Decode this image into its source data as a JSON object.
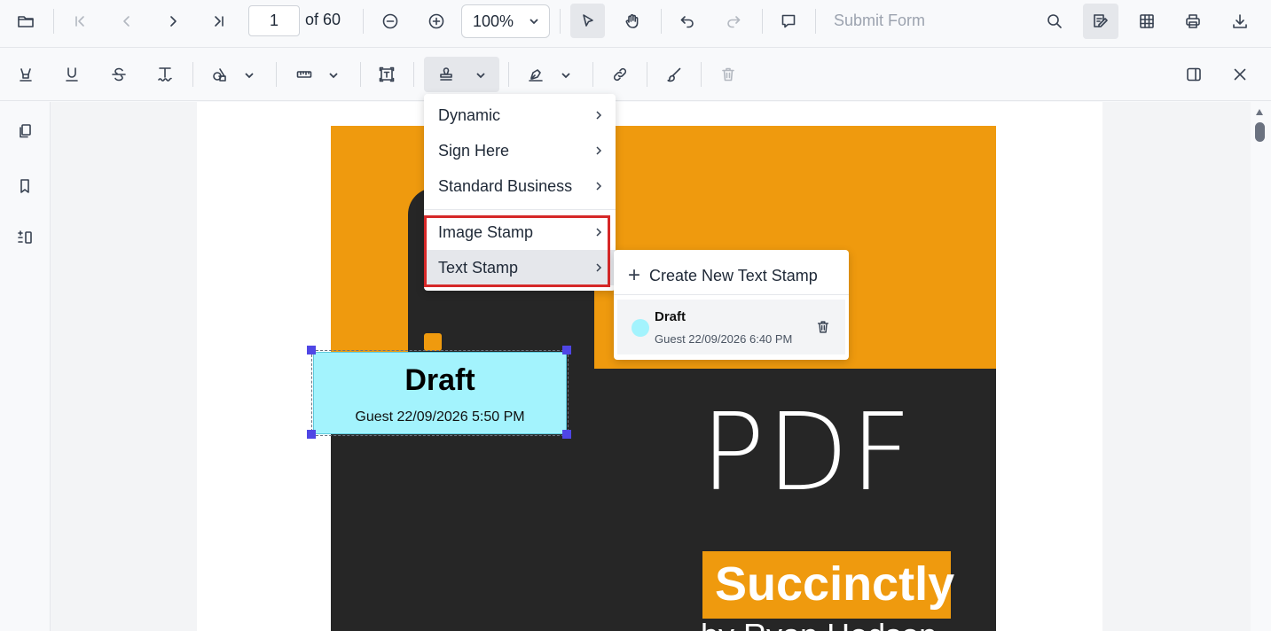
{
  "toolbar": {
    "page_current": "1",
    "page_of": "of 60",
    "zoom": "100%",
    "submit_form": "Submit Form"
  },
  "stamp_menu": {
    "items": [
      {
        "label": "Dynamic"
      },
      {
        "label": "Sign Here"
      },
      {
        "label": "Standard Business"
      },
      {
        "label": "Image Stamp"
      },
      {
        "label": "Text Stamp"
      }
    ]
  },
  "text_stamp_submenu": {
    "create_label": "Create New Text Stamp",
    "saved": {
      "name": "Draft",
      "meta": "Guest 22/09/2026 6:40 PM",
      "color": "#a3f3fd"
    }
  },
  "placed_stamp": {
    "title": "Draft",
    "meta": "Guest 22/09/2026 5:50 PM",
    "color": "#a3f3fd"
  },
  "document": {
    "cover_title": "PDF",
    "cover_subtitle": "Succinctly",
    "cover_byline": "by Ryan Hodson",
    "accent": "#ef9a0e",
    "dark": "#262626"
  }
}
